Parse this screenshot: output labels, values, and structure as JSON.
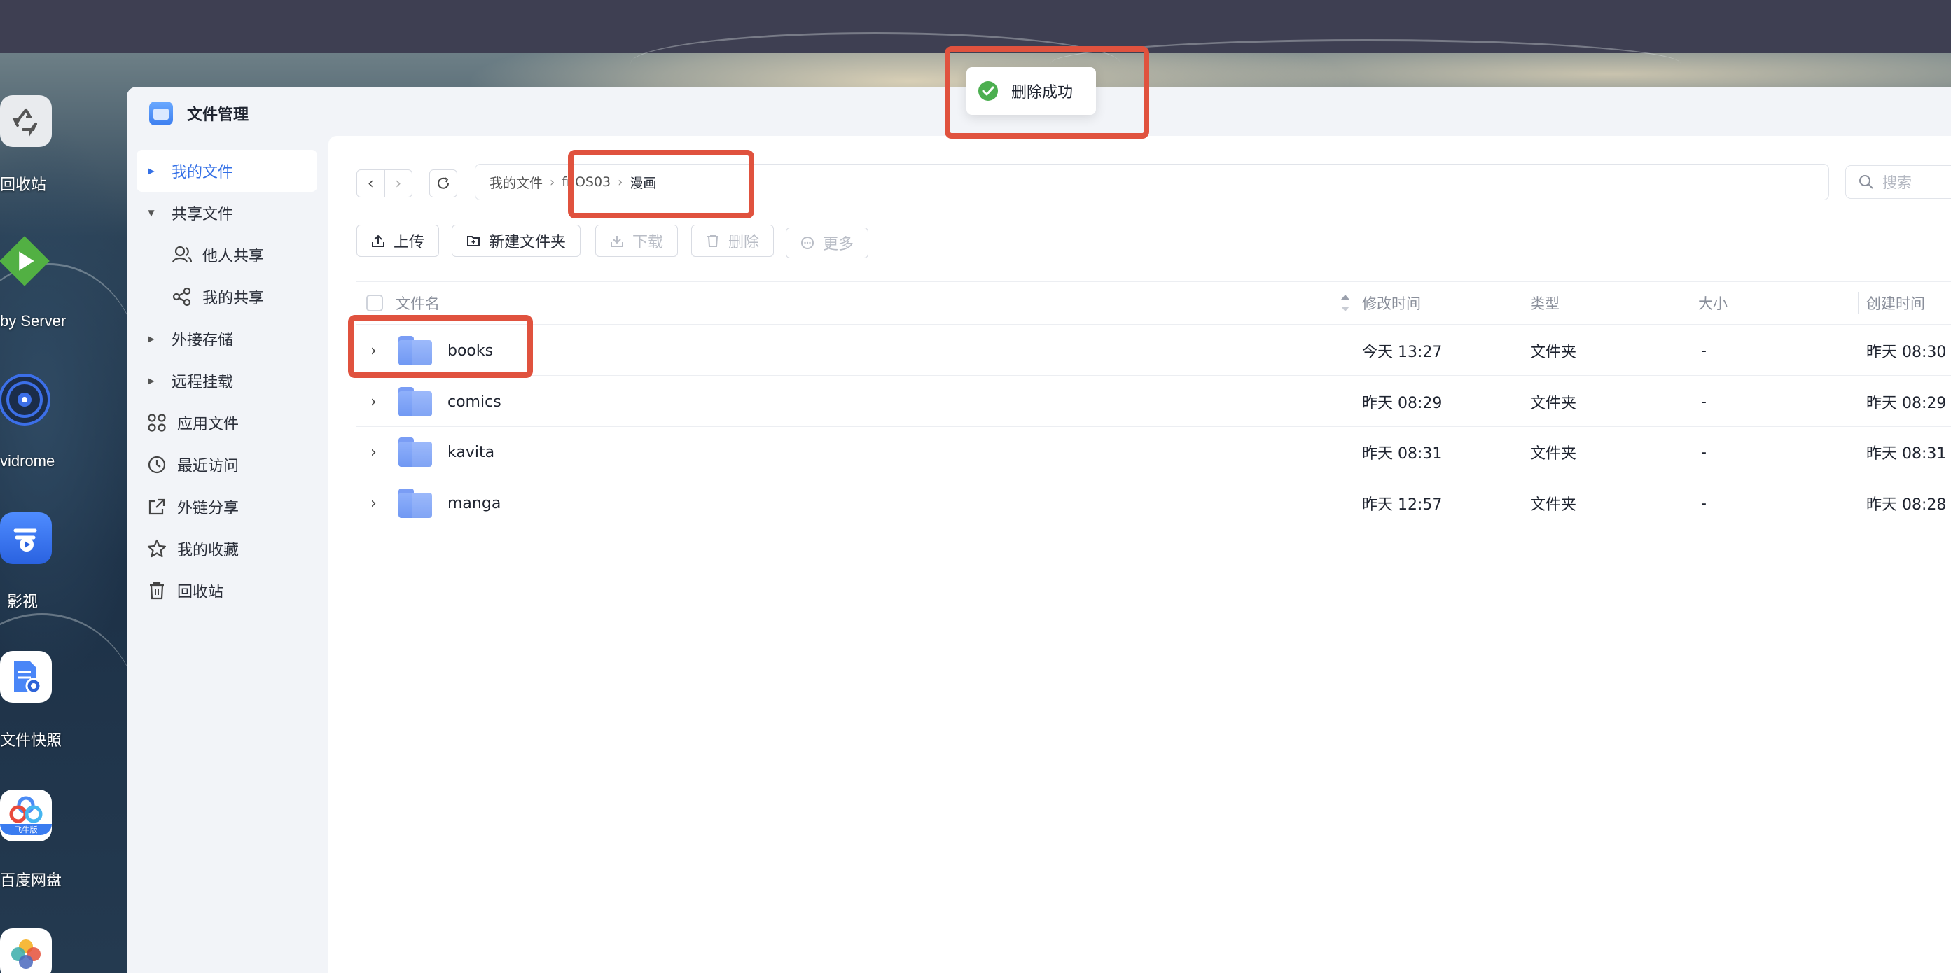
{
  "desktop": {
    "dock": [
      {
        "label": "回收站",
        "icon": "recycle-bin-icon"
      },
      {
        "label": "by Server",
        "icon": "play-server-icon"
      },
      {
        "label": "vidrome",
        "icon": "navidrome-disc-icon"
      },
      {
        "label": "影视",
        "icon": "video-app-icon"
      },
      {
        "label": "文件快照",
        "icon": "file-snapshot-icon"
      },
      {
        "label": "百度网盘",
        "icon": "baidu-netdisk-icon",
        "badge": "飞牛版"
      },
      {
        "label": "",
        "icon": "photos-icon"
      }
    ]
  },
  "window": {
    "title": "文件管理"
  },
  "sidebar": {
    "items": [
      {
        "label": "我的文件",
        "active": true
      },
      {
        "label": "共享文件"
      },
      {
        "label": "他人共享"
      },
      {
        "label": "我的共享"
      },
      {
        "label": "外接存储"
      },
      {
        "label": "远程挂载"
      },
      {
        "label": "应用文件"
      },
      {
        "label": "最近访问"
      },
      {
        "label": "外链分享"
      },
      {
        "label": "我的收藏"
      },
      {
        "label": "回收站"
      }
    ]
  },
  "pathbar": {
    "segments": [
      "我的文件",
      "fnOS03",
      "漫画"
    ]
  },
  "search": {
    "placeholder": "搜索"
  },
  "toolbar": {
    "upload": "上传",
    "new_folder": "新建文件夹",
    "download": "下载",
    "delete": "删除",
    "more": "更多"
  },
  "table": {
    "columns": [
      "文件名",
      "修改时间",
      "类型",
      "大小",
      "创建时间"
    ],
    "rows": [
      {
        "name": "books",
        "modified": "今天 13:27",
        "type": "文件夹",
        "size": "-",
        "created": "昨天 08:30"
      },
      {
        "name": "comics",
        "modified": "昨天 08:29",
        "type": "文件夹",
        "size": "-",
        "created": "昨天 08:29"
      },
      {
        "name": "kavita",
        "modified": "昨天 08:31",
        "type": "文件夹",
        "size": "-",
        "created": "昨天 08:31"
      },
      {
        "name": "manga",
        "modified": "昨天 12:57",
        "type": "文件夹",
        "size": "-",
        "created": "昨天 08:28"
      }
    ]
  },
  "toast": {
    "message": "删除成功"
  },
  "colors": {
    "accent": "#3470e6",
    "highlight": "#e0523e",
    "success": "#4caf50",
    "folder": "#7a9df5"
  }
}
